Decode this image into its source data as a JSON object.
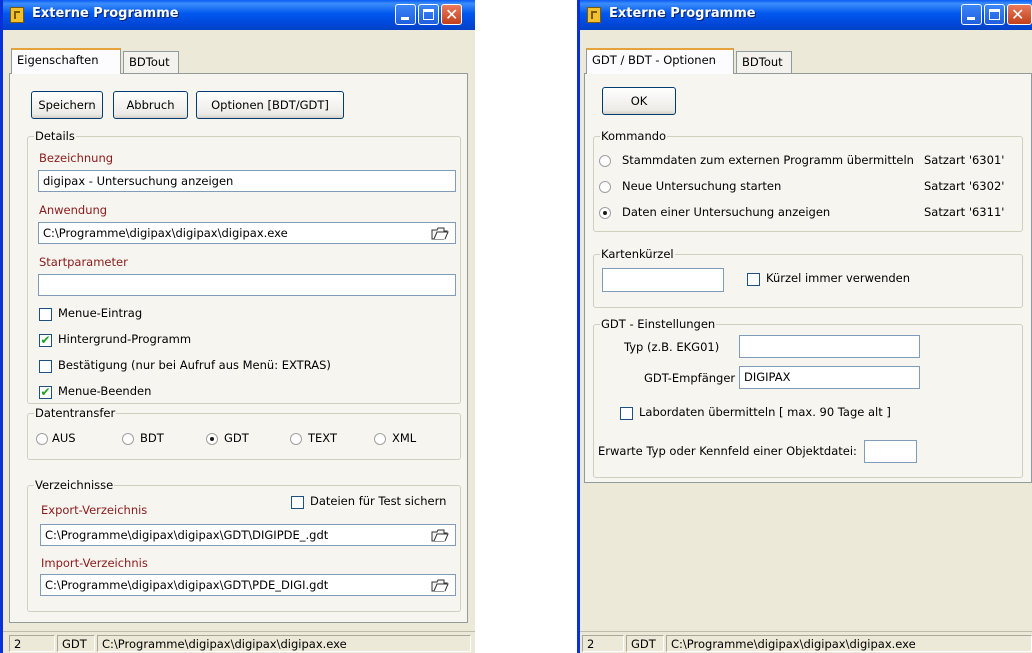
{
  "window1": {
    "title": "Externe Programme",
    "tabs": [
      "Eigenschaften",
      "BDTout"
    ],
    "buttons": {
      "save": "Speichern",
      "cancel": "Abbruch",
      "options": "Optionen [BDT/GDT]"
    },
    "details": {
      "legend": "Details",
      "bezeichnung_label": "Bezeichnung",
      "bezeichnung_value": "digipax - Untersuchung anzeigen",
      "anwendung_label": "Anwendung",
      "anwendung_value": "C:\\Programme\\digipax\\digipax\\digipax.exe",
      "startparameter_label": "Startparameter",
      "startparameter_value": "",
      "checkboxes": [
        {
          "label": "Menue-Eintrag",
          "checked": false
        },
        {
          "label": "Hintergrund-Programm",
          "checked": true
        },
        {
          "label": "Bestätigung  (nur bei Aufruf aus  Menü: EXTRAS)",
          "checked": false
        },
        {
          "label": "Menue-Beenden",
          "checked": true
        }
      ]
    },
    "datentransfer": {
      "legend": "Datentransfer",
      "options": [
        "AUS",
        "BDT",
        "GDT",
        "TEXT",
        "XML"
      ],
      "selected": "GDT"
    },
    "verzeichnisse": {
      "legend": "Verzeichnisse",
      "save_test_label": "Dateien für Test sichern",
      "save_test_checked": false,
      "export_label": "Export-Verzeichnis",
      "export_value": "C:\\Programme\\digipax\\digipax\\GDT\\DIGIPDE_.gdt",
      "import_label": "Import-Verzeichnis",
      "import_value": "C:\\Programme\\digipax\\digipax\\GDT\\PDE_DIGI.gdt"
    },
    "status": [
      "2",
      "GDT",
      "C:\\Programme\\digipax\\digipax\\digipax.exe"
    ]
  },
  "window2": {
    "title": "Externe Programme",
    "tabs": [
      "GDT / BDT - Optionen",
      "BDTout"
    ],
    "ok_label": "OK",
    "kommando": {
      "legend": "Kommando",
      "options": [
        {
          "label": "Stammdaten zum externen Programm übermitteln",
          "satzart": "Satzart  '6301'",
          "selected": false
        },
        {
          "label": "Neue Untersuchung starten",
          "satzart": "Satzart  '6302'",
          "selected": false
        },
        {
          "label": "Daten einer Untersuchung anzeigen",
          "satzart": "Satzart  '6311'",
          "selected": true
        }
      ]
    },
    "kartenkuerzel": {
      "legend": "Kartenkürzel",
      "value": "",
      "always_label": "Kürzel immer verwenden",
      "always_checked": false
    },
    "gdt": {
      "legend": "GDT - Einstellungen",
      "typ_label": "Typ (z.B. EKG01)",
      "typ_value": "",
      "empfaenger_label": "GDT-Empfänger",
      "empfaenger_value": "DIGIPAX",
      "labordaten_label": "Labordaten übermitteln  [ max. 90 Tage alt ]",
      "labordaten_checked": false,
      "erwarte_label": "Erwarte Typ oder Kennfeld einer Objektdatei:",
      "erwarte_value": ""
    },
    "status": [
      "2",
      "GDT",
      "C:\\Programme\\digipax\\digipax\\digipax.exe"
    ]
  }
}
